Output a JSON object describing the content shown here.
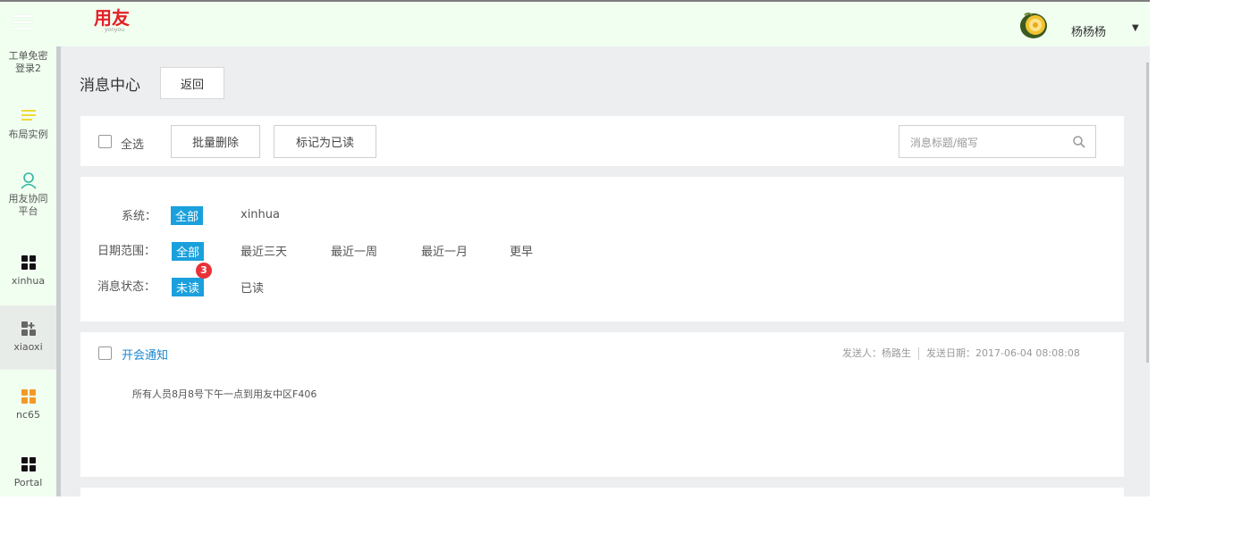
{
  "header": {
    "logo_text": "用友",
    "logo_subtext": "yonyou",
    "username": "杨杨杨",
    "caret": "▼"
  },
  "sidebar": {
    "items": [
      {
        "label": "工单免密登录2",
        "icon": "none"
      },
      {
        "label": "布局实例",
        "icon": "layout-list-icon",
        "color": "#f0d838"
      },
      {
        "label": "用友协同平台",
        "icon": "user-outline-icon",
        "color": "#2fb5a5"
      },
      {
        "label": "xinhua",
        "icon": "grid-icon",
        "color": "#111111"
      },
      {
        "label": "xiaoxi",
        "icon": "grid-plus-icon",
        "color": "#666666"
      },
      {
        "label": "nc65",
        "icon": "grid-icon",
        "color": "#f39a26"
      },
      {
        "label": "Portal",
        "icon": "grid-icon",
        "color": "#111111"
      }
    ]
  },
  "page": {
    "title": "消息中心",
    "back_label": "返回"
  },
  "toolbar": {
    "select_all_label": "全选",
    "batch_delete_label": "批量删除",
    "mark_read_label": "标记为已读",
    "search_placeholder": "消息标题/缩写"
  },
  "filters": {
    "system": {
      "label": "系统：",
      "options": [
        "全部",
        "xinhua"
      ],
      "selected": "全部"
    },
    "date": {
      "label": "日期范围：",
      "options": [
        "全部",
        "最近三天",
        "最近一周",
        "最近一月",
        "更早"
      ],
      "selected": "全部"
    },
    "status": {
      "label": "消息状态：",
      "options": [
        "未读",
        "已读"
      ],
      "selected": "未读",
      "unread_count": "3"
    }
  },
  "messages": [
    {
      "title": "开会通知",
      "sender": "发送人：杨路生",
      "date": "发送日期：2017-06-04 08:08:08",
      "body": "所有人员8月8号下午一点到用友中区F406"
    }
  ],
  "colors": {
    "accent": "#1aa0dc",
    "brand": "#e41f26",
    "badge": "#e8323a",
    "link": "#1a86d0"
  }
}
